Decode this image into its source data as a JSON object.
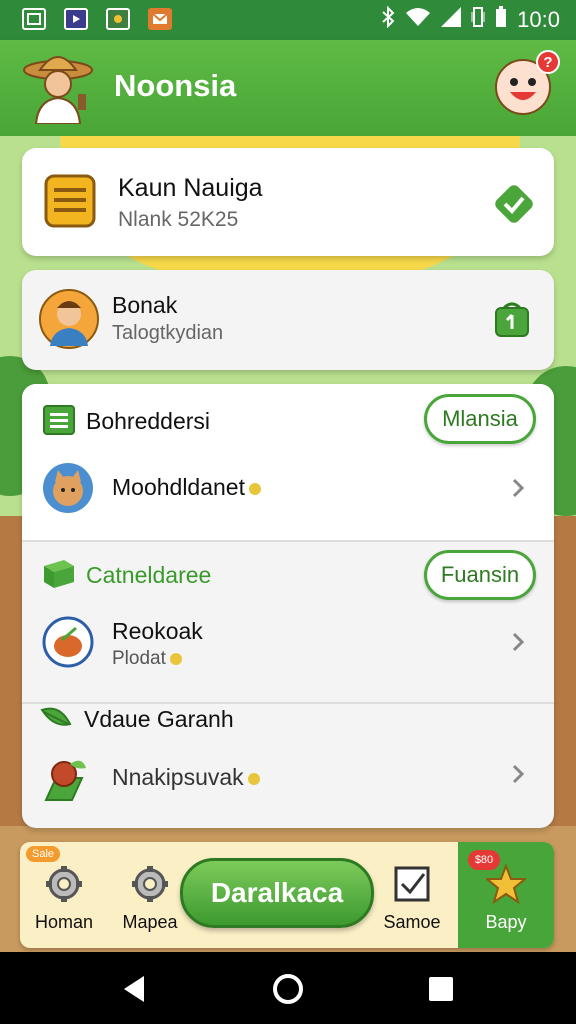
{
  "status_bar": {
    "time": "10:0",
    "icons": [
      "app-icon",
      "app-icon",
      "app-icon",
      "mail-icon",
      "bluetooth-icon",
      "wifi-icon",
      "signal-icon",
      "vibrate-icon",
      "battery-icon"
    ]
  },
  "header": {
    "title": "Noonsia",
    "notification_count": "?"
  },
  "account_card": {
    "title": "Kaun Nauiga",
    "subtitle": "Nlank 52K25"
  },
  "profile_card": {
    "name": "Bonak",
    "subtitle": "Talogtkydian"
  },
  "sections": [
    {
      "title": "Bohreddersi",
      "action": "Mlansia",
      "items": [
        {
          "label": "Moohdldanet"
        }
      ]
    },
    {
      "title": "Catneldaree",
      "action": "Fuansin",
      "items": [
        {
          "label": "Reokoak",
          "sub": "Plodat"
        }
      ]
    },
    {
      "title": "Vdaue Garanh",
      "items": [
        {
          "label": "Nnakipsuvak"
        }
      ]
    }
  ],
  "bottom_bar": {
    "promo": "Sale",
    "items": [
      "Homan",
      "Mapea"
    ],
    "cta": "Daralkaca",
    "samoe": "Samoe",
    "bapy": "Bapy",
    "bapy_badge": "$80"
  },
  "colors": {
    "primary_green": "#4aa63a",
    "header_green": "#5fba45",
    "status_green": "#2f8a3a",
    "accent_yellow": "#f2c037",
    "badge_red": "#e53935"
  }
}
